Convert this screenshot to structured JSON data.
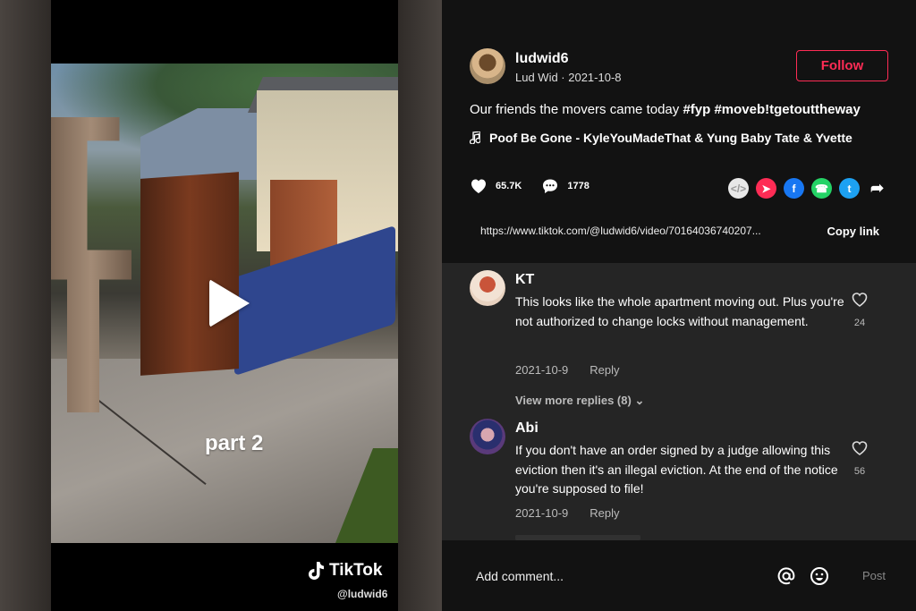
{
  "video": {
    "caption": "part 2",
    "watermark": "TikTok",
    "watermark_handle": "@ludwid6",
    "play_icon": "play-icon"
  },
  "author": {
    "username": "ludwid6",
    "subline": "Lud Wid · 2021-10-8",
    "follow_label": "Follow"
  },
  "post": {
    "description": "Our friends the movers came today ",
    "hashtags": "#fyp #moveb!tgetouttheway",
    "music": "Poof Be Gone - KyleYouMadeThat & Yung Baby Tate & Yvette",
    "likes": "65.7K",
    "comments": "1778",
    "url": "https://www.tiktok.com/@ludwid6/video/70164036740207...",
    "copy_label": "Copy link"
  },
  "share_icons": [
    "embed-icon",
    "send-icon",
    "facebook-icon",
    "whatsapp-icon",
    "twitter-icon",
    "share-arrow-icon"
  ],
  "comments": [
    {
      "name": "KT",
      "text": "This looks like the whole apartment moving out. Plus you're not authorized to change locks without management.",
      "date": "2021-10-9",
      "reply": "Reply",
      "likes": "24",
      "more": "View more replies (8)"
    },
    {
      "name": "Abi",
      "text": "If you don't have an order signed by a judge allowing this eviction then it's an illegal eviction. At the end of the notice you're supposed to file!",
      "date": "2021-10-9",
      "reply": "Reply",
      "likes": "56"
    }
  ],
  "footer": {
    "placeholder": "Add comment...",
    "post_label": "Post"
  },
  "colors": {
    "accent": "#fe2c55",
    "panel_bg": "#121212",
    "comments_bg": "#252525"
  }
}
